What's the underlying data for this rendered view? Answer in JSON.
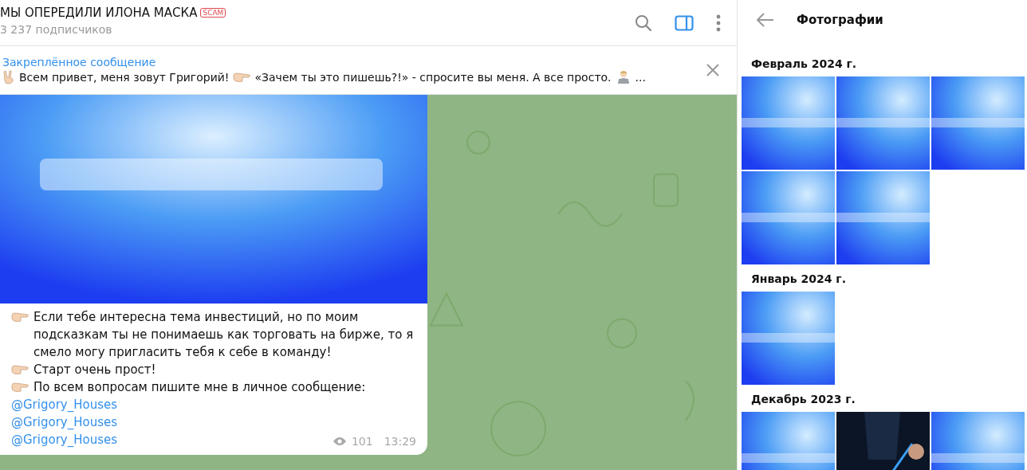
{
  "chat": {
    "title": "МЫ ОПЕРЕДИЛИ ИЛОНА МАСКА",
    "badge": "SCAM",
    "subtitle": "3 237 подписчиков",
    "side_panel_open": true
  },
  "pinned": {
    "label": "Закреплённое сообщение",
    "parts": [
      {
        "kind": "victory-hand"
      },
      {
        "kind": "text",
        "text": "Всем привет, меня зовут Григорий!"
      },
      {
        "kind": "pointing-hand"
      },
      {
        "kind": "text",
        "text": "«Зачем ты это пишешь?!» - спросите вы меня. А все просто."
      },
      {
        "kind": "laptop-person"
      },
      {
        "kind": "text",
        "text": "..."
      }
    ]
  },
  "message": {
    "lines": [
      {
        "kind": "bullet",
        "text": "Если тебе интересна тема инвестиций, но по моим подсказкам ты не понимаешь как торговать на бирже, то я смело могу пригласить тебя к себе в команду!"
      },
      {
        "kind": "bullet",
        "text": "Старт очень прост!"
      },
      {
        "kind": "bullet",
        "text": "По всем вопросам пишите мне в личное сообщение:"
      },
      {
        "kind": "link",
        "text": "@Grigory_Houses"
      },
      {
        "kind": "link",
        "text": "@Grigory_Houses"
      },
      {
        "kind": "link",
        "text": "@Grigory_Houses"
      }
    ],
    "views": "101",
    "time": "13:29"
  },
  "panel": {
    "title": "Фотографии",
    "groups": [
      {
        "label": "Февраль 2024 г.",
        "photos": [
          {
            "kind": "banner"
          },
          {
            "kind": "banner"
          },
          {
            "kind": "banner"
          },
          {
            "kind": "banner"
          },
          {
            "kind": "banner"
          }
        ]
      },
      {
        "label": "Январь 2024 г.",
        "photos": [
          {
            "kind": "banner"
          }
        ]
      },
      {
        "label": "Декабрь 2023 г.",
        "photos": [
          {
            "kind": "banner"
          },
          {
            "kind": "dark"
          },
          {
            "kind": "banner"
          }
        ]
      }
    ]
  }
}
